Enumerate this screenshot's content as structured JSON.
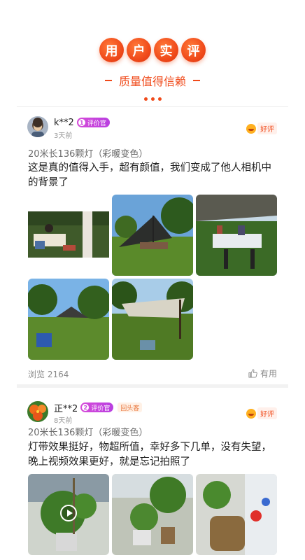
{
  "header": {
    "title_chars": [
      "用",
      "户",
      "实",
      "评"
    ],
    "subtitle": "质量值得信赖",
    "accent_color": "#f04a1a"
  },
  "reviews": [
    {
      "user": "k**2",
      "level": "1",
      "badge": "评价官",
      "time": "3天前",
      "rating_label": "好评",
      "spec": "20米长136颗灯（彩暖变色）",
      "content": "这是真的值得入手，超有颜值，我们变成了他人相机中的背景了",
      "views": "浏览 2164",
      "useful": "有用"
    },
    {
      "user": "正**2",
      "level": "2",
      "badge": "评价官",
      "extra_badge": "回头客",
      "time": "8天前",
      "rating_label": "好评",
      "spec": "20米长136颗灯（彩暖变色）",
      "content": "灯带效果挺好，物超所值，幸好多下几单，没有失望，晚上视频效果更好，就是忘记拍照了"
    }
  ],
  "icons": {
    "good_review": "smile-face-icon",
    "useful": "thumbs-up-icon",
    "video": "play-icon"
  }
}
